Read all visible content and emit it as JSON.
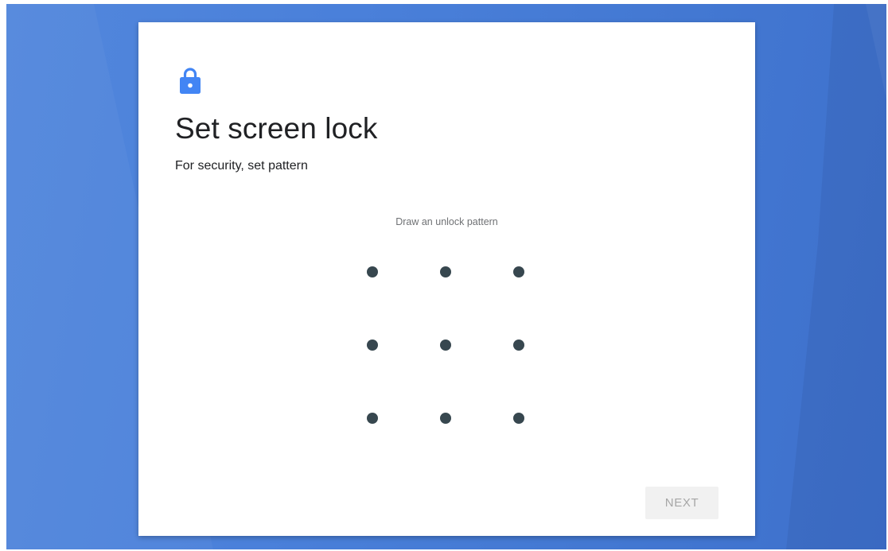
{
  "dialog": {
    "icon": "lock-icon",
    "title": "Set screen lock",
    "subtitle": "For security, set pattern",
    "hint": "Draw an unlock pattern",
    "next_label": "NEXT",
    "next_enabled": false
  },
  "pattern": {
    "rows": 3,
    "cols": 3
  },
  "colors": {
    "accent": "#4285f4",
    "dot": "#37474f",
    "background": "#4a80da"
  }
}
